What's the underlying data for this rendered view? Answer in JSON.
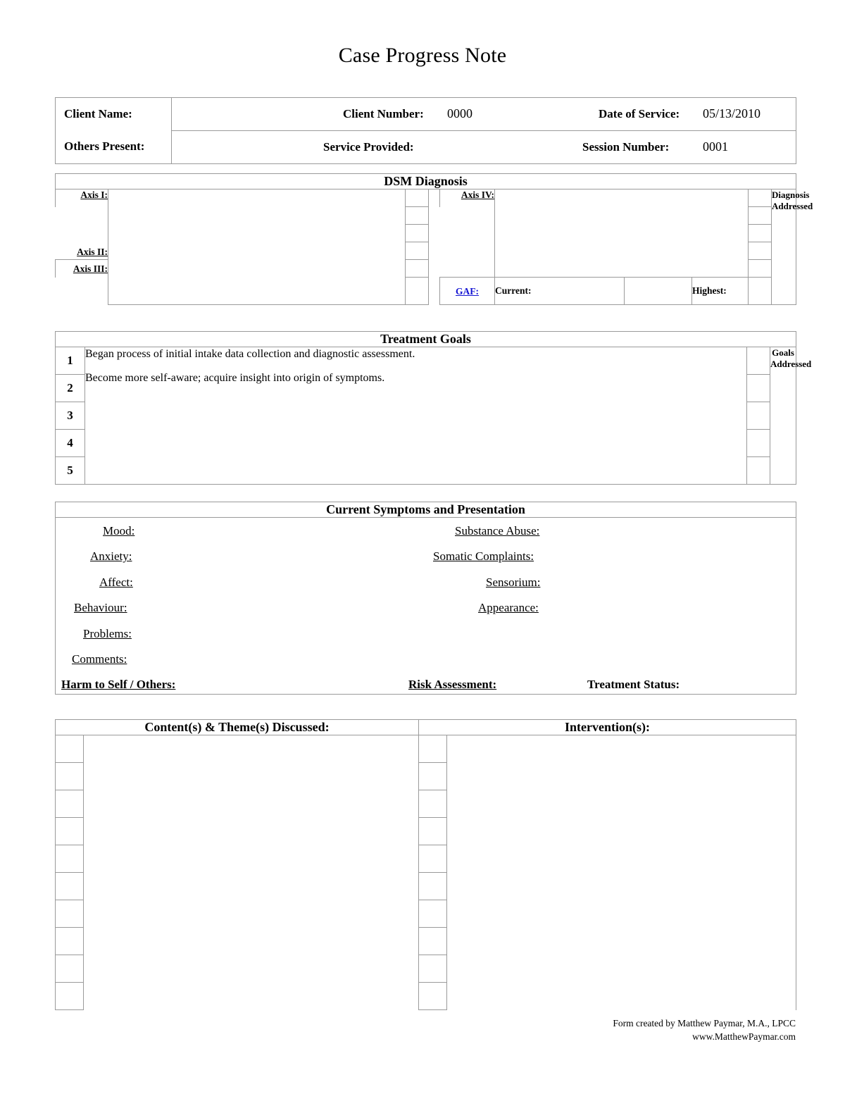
{
  "document": {
    "title": "Case Progress Note"
  },
  "header": {
    "client_name_label": "Client Name:",
    "others_present_label": "Others Present:",
    "client_number_label": "Client Number:",
    "client_number_value": "0000",
    "service_provided_label": "Service Provided:",
    "service_provided_value": "",
    "date_of_service_label": "Date of Service:",
    "date_of_service_value": "05/13/2010",
    "session_number_label": "Session Number:",
    "session_number_value": "0001"
  },
  "dsm": {
    "banner": "DSM Diagnosis",
    "axis_i_label": "Axis I:",
    "axis_ii_label": "Axis II:",
    "axis_iii_label": "Axis III:",
    "axis_iv_label": "Axis IV:",
    "gaf_label": "GAF:",
    "current_label": "Current:",
    "current_value": "",
    "highest_label": "Highest:",
    "highest_value": "",
    "side_caption": "Diagnosis Addressed",
    "axis_i_value": "",
    "axis_ii_value": "",
    "axis_iii_value": "",
    "axis_iv_value": "",
    "left_checkboxes": [
      "",
      "",
      "",
      "",
      ""
    ],
    "right_checkboxes": [
      "",
      "",
      "",
      "",
      ""
    ]
  },
  "goals": {
    "banner": "Treatment Goals",
    "numbers": [
      "1",
      "2",
      "3",
      "4",
      "5"
    ],
    "items": [
      "Began process of initial intake data collection and diagnostic assessment.",
      "Become more self-aware; acquire insight into origin of symptoms.",
      "",
      "",
      ""
    ],
    "side_caption": "Goals Addressed",
    "checkboxes": [
      "",
      "",
      "",
      "",
      ""
    ]
  },
  "symptoms": {
    "banner": "Current Symptoms and Presentation",
    "left_fields": [
      "Mood:",
      "Anxiety:",
      "Affect:",
      "Behaviour:",
      "Problems:",
      "Comments:"
    ],
    "right_fields": [
      "Substance Abuse:",
      "Somatic Complaints:",
      "Sensorium:",
      "Appearance:"
    ],
    "harm_label": "Harm to Self / Others:",
    "risk_label": "Risk Assessment:",
    "status_label": "Treatment Status:",
    "harm_value": "",
    "risk_value": "",
    "status_value": ""
  },
  "bottom": {
    "content_header": "Content(s) & Theme(s) Discussed:",
    "intervention_header": "Intervention(s):",
    "content_checkboxes": [
      "",
      "",
      "",
      "",
      "",
      "",
      "",
      "",
      "",
      ""
    ],
    "intervention_checkboxes": [
      "",
      "",
      "",
      "",
      "",
      "",
      "",
      "",
      "",
      ""
    ],
    "content_body": "",
    "intervention_body": ""
  },
  "footer": {
    "line1": "Form created by Matthew Paymar, M.A., LPCC",
    "line2": "www.MatthewPaymar.com"
  },
  "colors": {
    "border": "#9a9a9a",
    "link": "#1414d2",
    "text": "#000000"
  }
}
